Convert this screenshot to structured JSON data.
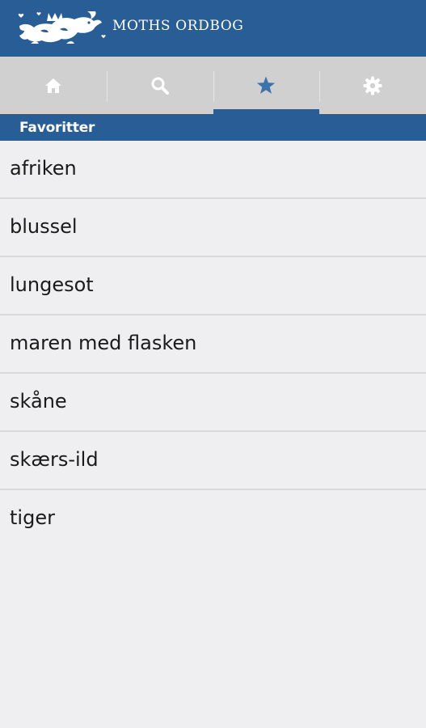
{
  "app": {
    "title": "MOTHS ORDBOG",
    "brand_color": "#285d95"
  },
  "tabs": [
    {
      "name": "home",
      "icon": "home-icon",
      "active": false
    },
    {
      "name": "search",
      "icon": "search-icon",
      "active": false
    },
    {
      "name": "favorites",
      "icon": "star-icon",
      "active": true
    },
    {
      "name": "settings",
      "icon": "gear-icon",
      "active": false
    }
  ],
  "section": {
    "title": "Favoritter"
  },
  "favorites": [
    "afriken",
    "blussel",
    "lungesot",
    "maren med flasken",
    "skåne",
    "skærs-ild",
    "tiger"
  ]
}
